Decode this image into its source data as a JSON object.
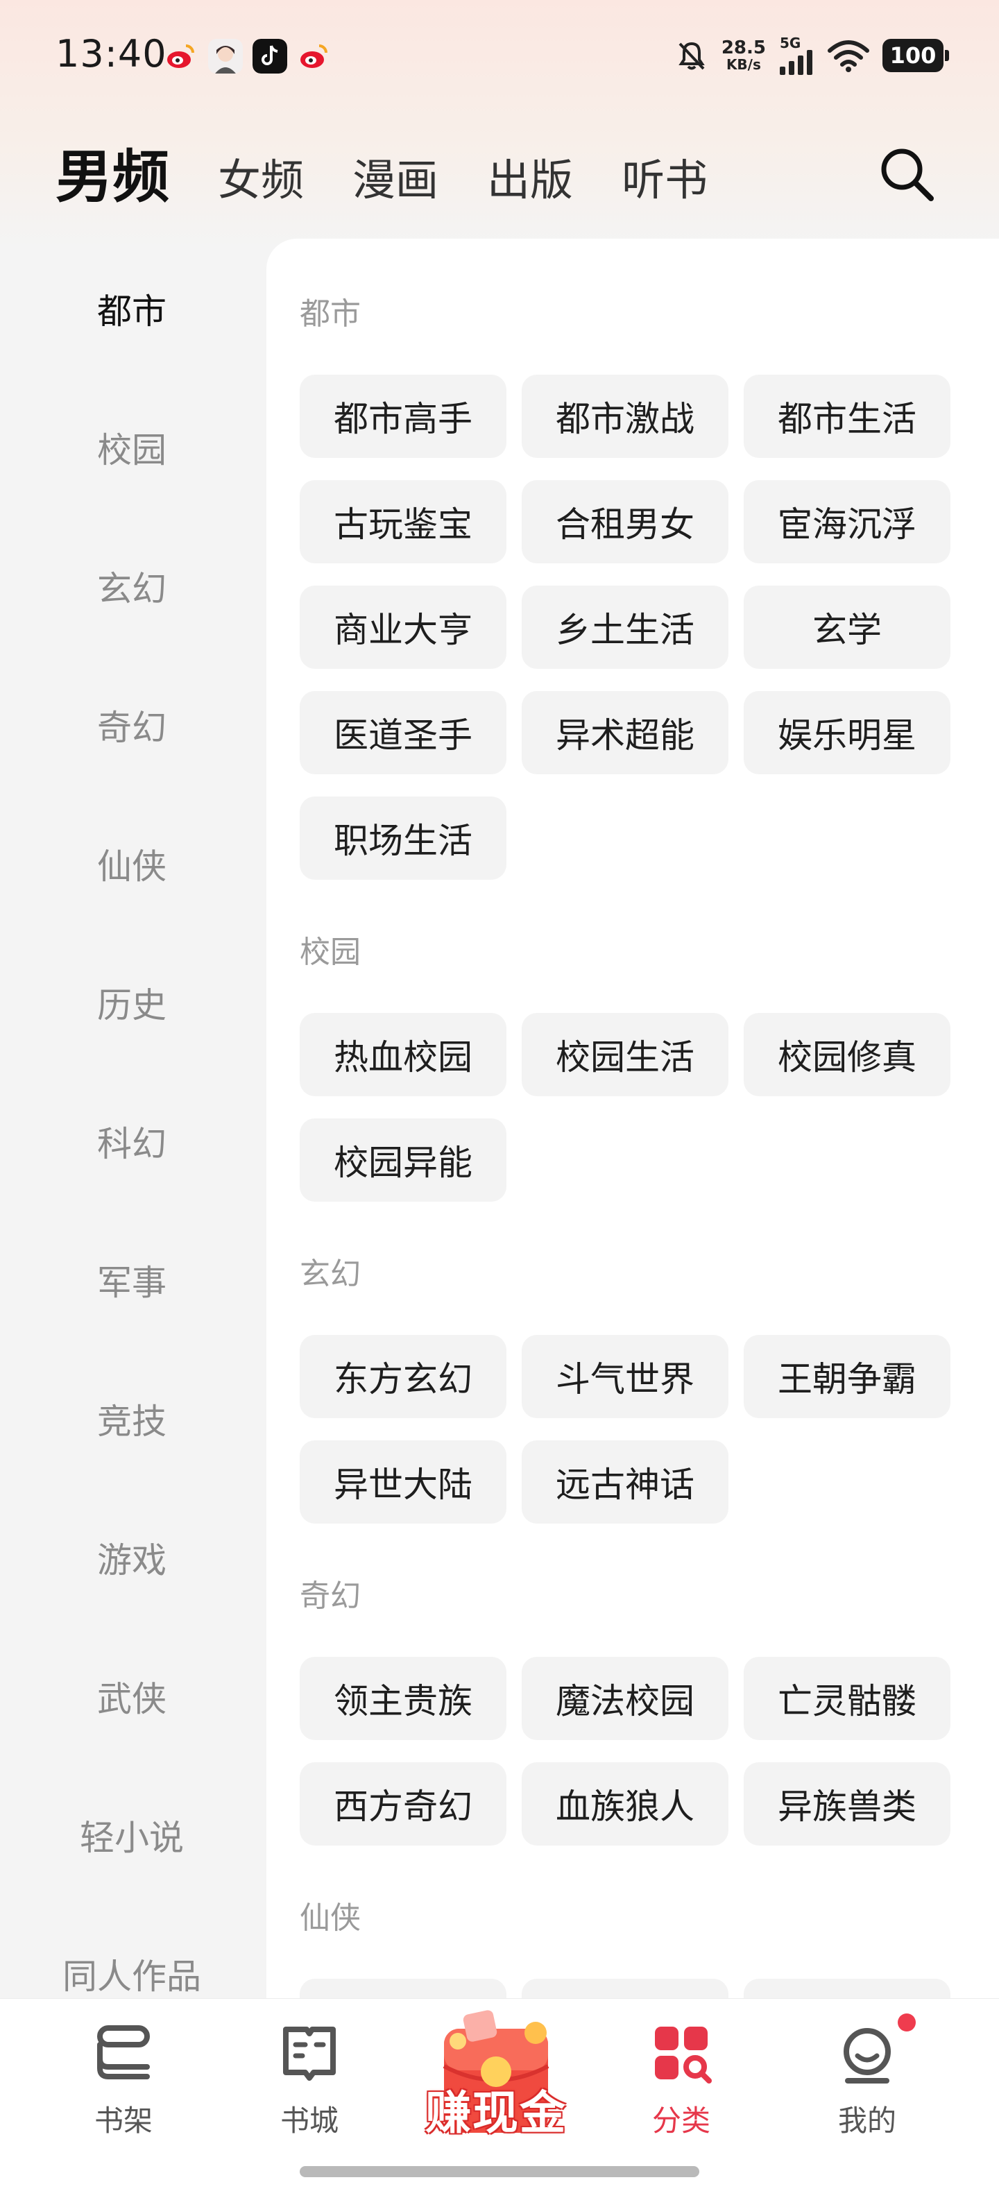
{
  "status_bar": {
    "time": "13:40",
    "app_icons": [
      "weibo-icon",
      "avatar-app-icon",
      "tiktok-icon",
      "weibo-icon"
    ],
    "net_speed_value": "28.5",
    "net_speed_unit": "KB/s",
    "network_type": "5G",
    "battery": "100",
    "icons": [
      "mute-bell-icon",
      "signal-icon",
      "wifi-icon",
      "battery-icon"
    ]
  },
  "channels": [
    {
      "label": "男频",
      "active": true
    },
    {
      "label": "女频",
      "active": false
    },
    {
      "label": "漫画",
      "active": false
    },
    {
      "label": "出版",
      "active": false
    },
    {
      "label": "听书",
      "active": false
    }
  ],
  "categories": [
    {
      "label": "都市",
      "active": true
    },
    {
      "label": "校园",
      "active": false
    },
    {
      "label": "玄幻",
      "active": false
    },
    {
      "label": "奇幻",
      "active": false
    },
    {
      "label": "仙侠",
      "active": false
    },
    {
      "label": "历史",
      "active": false
    },
    {
      "label": "科幻",
      "active": false
    },
    {
      "label": "军事",
      "active": false
    },
    {
      "label": "竞技",
      "active": false
    },
    {
      "label": "游戏",
      "active": false
    },
    {
      "label": "武侠",
      "active": false
    },
    {
      "label": "轻小说",
      "active": false
    },
    {
      "label": "同人作品",
      "active": false
    }
  ],
  "sections": [
    {
      "title": "都市",
      "tags": [
        "都市高手",
        "都市激战",
        "都市生活",
        "古玩鉴宝",
        "合租男女",
        "宦海沉浮",
        "商业大亨",
        "乡土生活",
        "玄学",
        "医道圣手",
        "异术超能",
        "娱乐明星",
        "职场生活"
      ]
    },
    {
      "title": "校园",
      "tags": [
        "热血校园",
        "校园生活",
        "校园修真",
        "校园异能"
      ]
    },
    {
      "title": "玄幻",
      "tags": [
        "东方玄幻",
        "斗气世界",
        "王朝争霸",
        "异世大陆",
        "远古神话"
      ]
    },
    {
      "title": "奇幻",
      "tags": [
        "领主贵族",
        "魔法校园",
        "亡灵骷髅",
        "西方奇幻",
        "血族狼人",
        "异族兽类"
      ]
    },
    {
      "title": "仙侠",
      "tags": [
        "",
        "",
        ""
      ]
    }
  ],
  "bottom_nav": {
    "items": [
      {
        "label": "书架",
        "icon": "bookshelf-icon",
        "active": false
      },
      {
        "label": "书城",
        "icon": "book-city-icon",
        "active": false
      },
      {
        "label": "分类",
        "icon": "category-icon",
        "active": true
      },
      {
        "label": "我的",
        "icon": "profile-icon",
        "active": false
      }
    ],
    "promo_label": "赚现金",
    "has_notification": true
  },
  "colors": {
    "accent": "#e6374a",
    "tag_bg": "#f3f3f3",
    "sidebar_bg": "#f4f4f4"
  }
}
